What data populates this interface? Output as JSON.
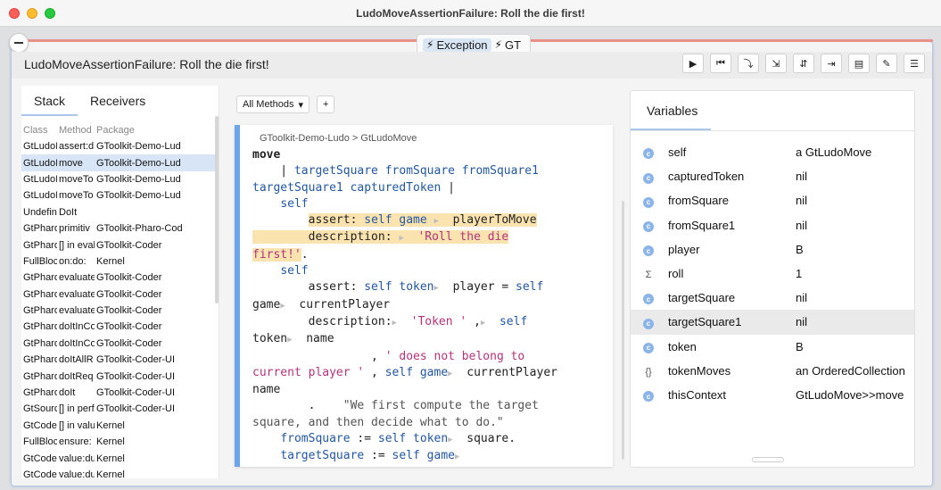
{
  "window": {
    "title": "LudoMoveAssertionFailure: Roll the die first!"
  },
  "tabs": {
    "exception": "Exception",
    "gt": "GT"
  },
  "header": {
    "title": "LudoMoveAssertionFailure: Roll the die first!"
  },
  "toolbar": [
    "play-icon",
    "step-to-start-icon",
    "step-into-icon",
    "step-over-icon",
    "step-through-icon",
    "run-to-icon",
    "clipboard-icon",
    "edit-icon",
    "menu-icon"
  ],
  "toolbar_glyphs": [
    "▶",
    "⏮",
    "⤵",
    "⇲",
    "⇵",
    "⇥",
    "▤",
    "✎",
    "☰"
  ],
  "stack": {
    "tabs": [
      "Stack",
      "Receivers"
    ],
    "columns": [
      "Class",
      "Method",
      "Package"
    ],
    "rows": [
      [
        "GtLudoI",
        "assert:d",
        "GToolkit-Demo-Lud"
      ],
      [
        "GtLudoI",
        "move",
        "GToolkit-Demo-Lud"
      ],
      [
        "GtLudoI",
        "moveTo",
        "GToolkit-Demo-Lud"
      ],
      [
        "GtLudoI",
        "moveTo",
        "GToolkit-Demo-Lud"
      ],
      [
        "Undefin",
        "DoIt",
        ""
      ],
      [
        "GtPharo",
        "primitiv",
        "GToolkit-Pharo-Cod"
      ],
      [
        "GtPharo",
        "[] in eval",
        "GToolkit-Coder"
      ],
      [
        "FullBloc",
        "on:do:",
        "Kernel"
      ],
      [
        "GtPharo",
        "evaluate",
        "GToolkit-Coder"
      ],
      [
        "GtPharo",
        "evaluate",
        "GToolkit-Coder"
      ],
      [
        "GtPharo",
        "evaluate",
        "GToolkit-Coder"
      ],
      [
        "GtPharo",
        "doItInCo",
        "GToolkit-Coder"
      ],
      [
        "GtPharo",
        "doItInCo",
        "GToolkit-Coder"
      ],
      [
        "GtPharo",
        "doItAllR",
        "GToolkit-Coder-UI"
      ],
      [
        "GtPharo",
        "doItReq",
        "GToolkit-Coder-UI"
      ],
      [
        "GtPharo",
        "doIt",
        "GToolkit-Coder-UI"
      ],
      [
        "GtSourc",
        "[] in perf",
        "GToolkit-Coder-UI"
      ],
      [
        "GtCoder",
        "[] in valu",
        "Kernel"
      ],
      [
        "FullBloc",
        "ensure:",
        "Kernel"
      ],
      [
        "GtCoder",
        "value:du",
        "Kernel"
      ],
      [
        "GtCoder",
        "value:du",
        "Kernel"
      ]
    ]
  },
  "methods": {
    "filter": "All Methods",
    "add": "+"
  },
  "editor": {
    "breadcrumb": "GToolkit-Demo-Ludo  >  GtLudoMove",
    "method": "move"
  },
  "variables": {
    "tab": "Variables",
    "rows": [
      {
        "icon": "c",
        "name": "self",
        "value": "a GtLudoMove"
      },
      {
        "icon": "c",
        "name": "capturedToken",
        "value": "nil"
      },
      {
        "icon": "c",
        "name": "fromSquare",
        "value": "nil"
      },
      {
        "icon": "c",
        "name": "fromSquare1",
        "value": "nil"
      },
      {
        "icon": "c",
        "name": "player",
        "value": "B"
      },
      {
        "icon": "Σ",
        "name": "roll",
        "value": "1"
      },
      {
        "icon": "c",
        "name": "targetSquare",
        "value": "nil"
      },
      {
        "icon": "c",
        "name": "targetSquare1",
        "value": "nil"
      },
      {
        "icon": "c",
        "name": "token",
        "value": "B"
      },
      {
        "icon": "{}",
        "name": "tokenMoves",
        "value": "an OrderedCollection"
      },
      {
        "icon": "c",
        "name": "thisContext",
        "value": "GtLudoMove>>move"
      }
    ]
  }
}
